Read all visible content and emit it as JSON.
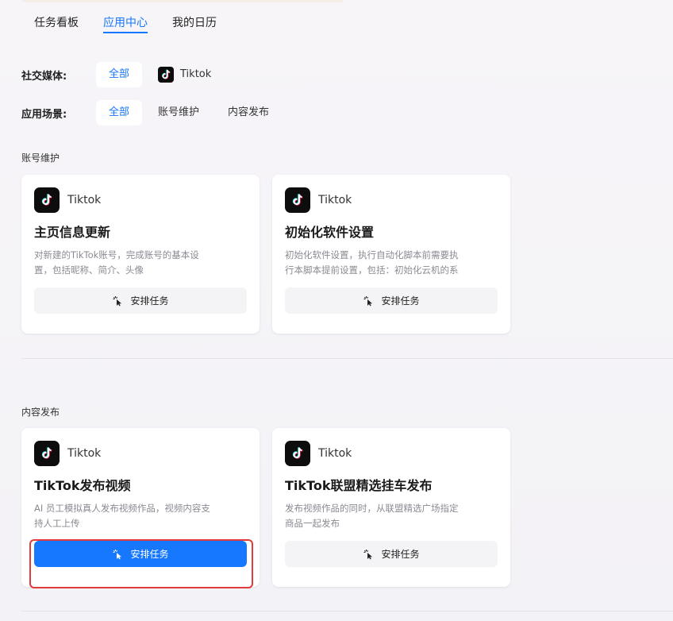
{
  "tabs": [
    {
      "label": "任务看板",
      "active": false
    },
    {
      "label": "应用中心",
      "active": true
    },
    {
      "label": "我的日历",
      "active": false
    }
  ],
  "filters": {
    "social": {
      "label": "社交媒体:",
      "options": [
        "全部",
        "Tiktok"
      ]
    },
    "scene": {
      "label": "应用场景:",
      "options": [
        "全部",
        "账号维护",
        "内容发布"
      ]
    }
  },
  "sections": [
    {
      "title": "账号维护",
      "cards": [
        {
          "platform": "Tiktok",
          "title": "主页信息更新",
          "desc": "对新建的TikTok账号，完成账号的基本设置，包括昵称、简介、头像",
          "button": "安排任务"
        },
        {
          "platform": "Tiktok",
          "title": "初始化软件设置",
          "desc": "初始化软件设置，执行自动化脚本前需要执行本脚本提前设置，包括：初始化云机的系统...",
          "button": "安排任务"
        }
      ]
    },
    {
      "title": "内容发布",
      "cards": [
        {
          "platform": "Tiktok",
          "title": "TikTok发布视频",
          "desc": "AI 员工模拟真人发布视频作品，视频内容支持人工上传",
          "button": "安排任务"
        },
        {
          "platform": "Tiktok",
          "title": "TikTok联盟精选挂车发布",
          "desc": "发布视频作品的同时，从联盟精选广场指定商品一起发布",
          "button": "安排任务"
        }
      ]
    }
  ],
  "icons": {
    "platform": "tiktok-icon",
    "button": "click-icon"
  },
  "colors": {
    "accent": "#1677ff",
    "highlight": "#e23b3b"
  }
}
